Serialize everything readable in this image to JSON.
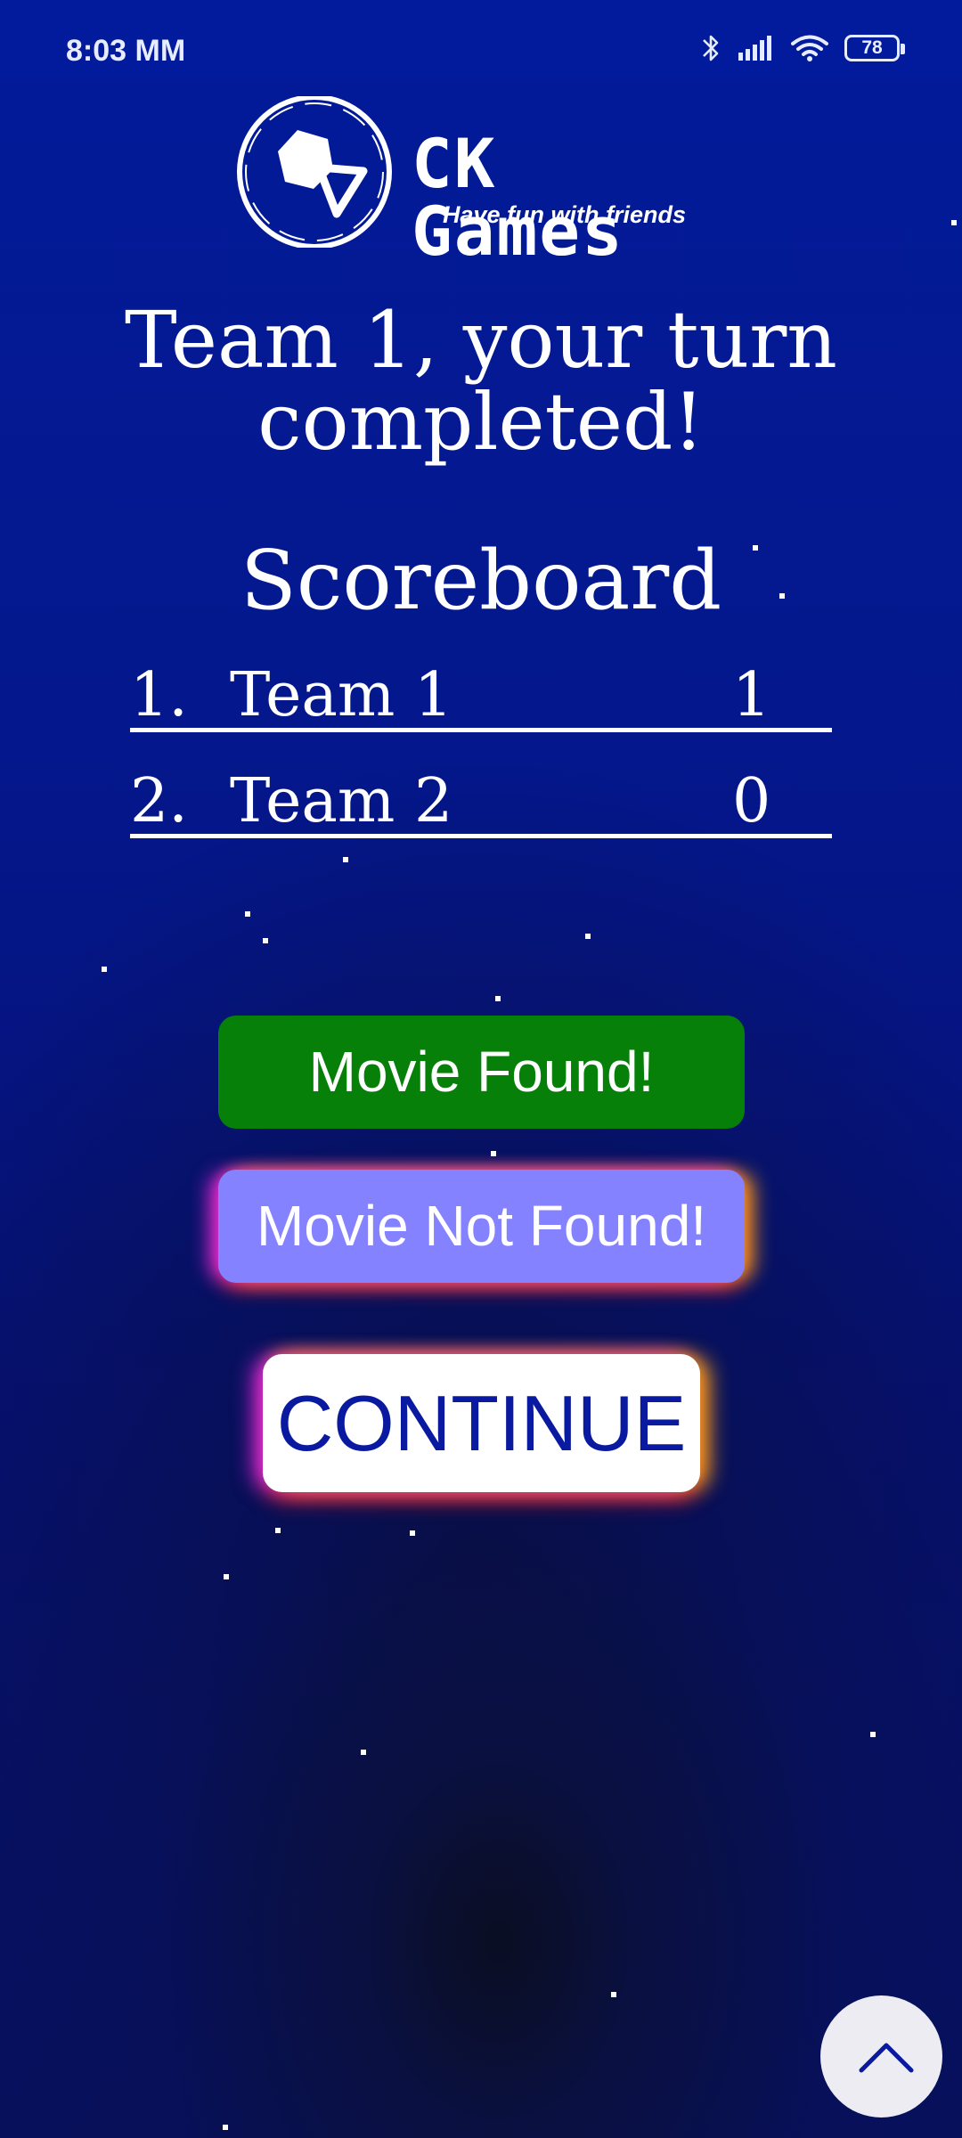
{
  "status_bar": {
    "time": "8:03 MM",
    "battery_level": "78",
    "icons": [
      "bluetooth-icon",
      "signal-icon",
      "wifi-icon",
      "battery-icon"
    ]
  },
  "logo": {
    "name": "CK Games",
    "tagline": "Have fun with friends"
  },
  "turn_message": {
    "line1": "Team 1, your turn",
    "line2": "completed!"
  },
  "scoreboard": {
    "title": "Scoreboard",
    "rows": [
      {
        "rank": "1.",
        "team": "Team 1",
        "score": "1"
      },
      {
        "rank": "2.",
        "team": "Team 2",
        "score": "0"
      }
    ]
  },
  "buttons": {
    "found": "Movie Found!",
    "not_found": "Movie Not Found!",
    "continue": "CONTINUE"
  },
  "colors": {
    "background": "#031796",
    "found_button": "#068009",
    "not_found_button": "#8582ff",
    "continue_text": "#0a1aa0"
  }
}
